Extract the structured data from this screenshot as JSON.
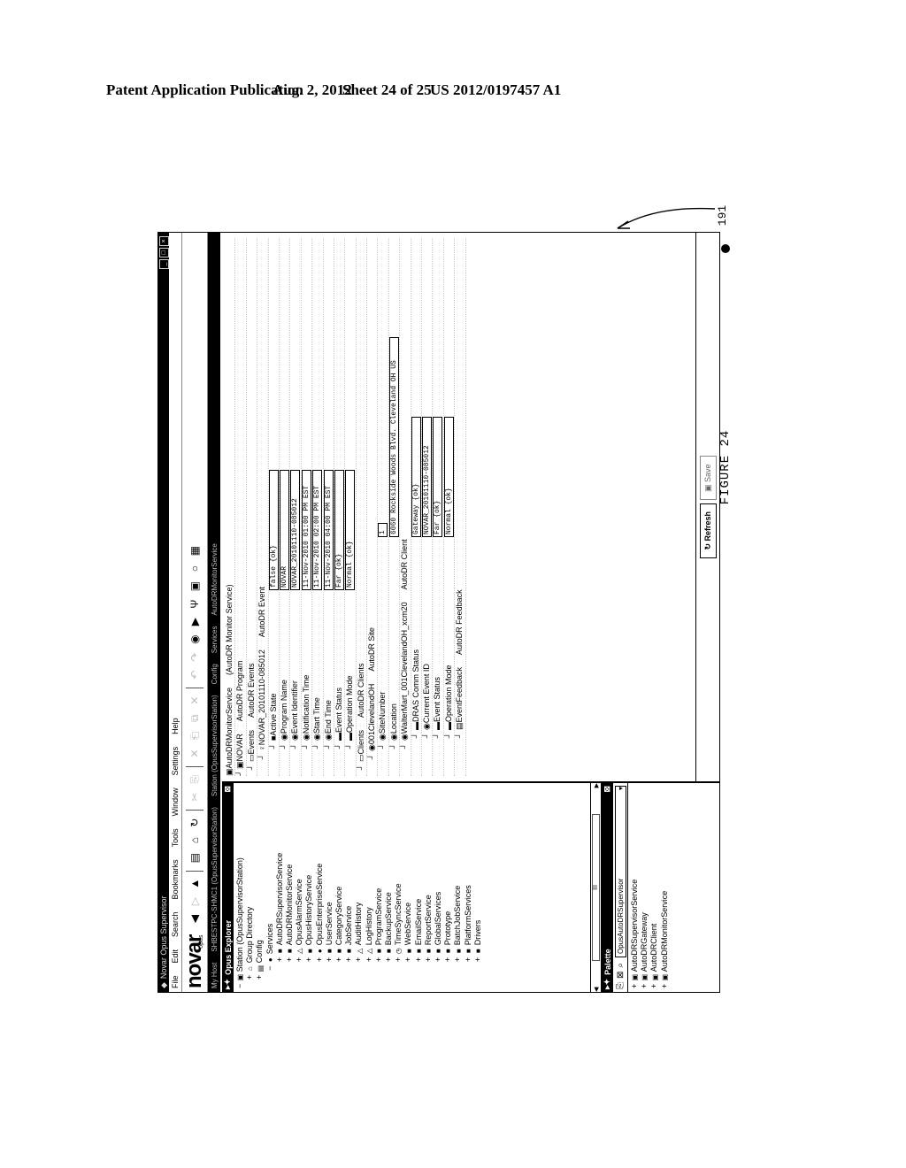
{
  "patent": {
    "title": "Patent Application Publication",
    "date": "Aug. 2, 2012",
    "sheet": "Sheet 24 of 25",
    "number": "US 2012/0197457 A1",
    "figure": "FIGURE 24",
    "reference": "191"
  },
  "window": {
    "title": "Novar Opus Supervisor",
    "menu": [
      "File",
      "Edit",
      "Search",
      "Bookmarks",
      "Tools",
      "Window",
      "Settings",
      "Help"
    ],
    "logo": "novar",
    "logo_sub": "opus",
    "address": [
      "My Host",
      "SHBESTPC-SHMC1 (OpusSupervisorStation)",
      "Station (OpusSupervisorStation)",
      "Config",
      "Services",
      "AutoDRMonitorService"
    ]
  },
  "explorer": {
    "title": "Opus Explorer",
    "items": [
      {
        "label": "Station (OpusSupervisorStation)",
        "icon": "station-icon"
      },
      {
        "label": "Group Directory",
        "icon": "folder-icon"
      },
      {
        "label": "Config",
        "icon": "config-icon"
      },
      {
        "label": "Services",
        "icon": "services-icon"
      },
      {
        "label": "AutoDRSupervisorService",
        "icon": "service-icon"
      },
      {
        "label": "AutoDRMonitorService",
        "icon": "service-icon"
      },
      {
        "label": "OpusAlarmService",
        "icon": "bell-icon"
      },
      {
        "label": "OpusHistoryService",
        "icon": "history-icon"
      },
      {
        "label": "OpusEnterpriseService",
        "icon": "globe-icon"
      },
      {
        "label": "UserService",
        "icon": "user-icon"
      },
      {
        "label": "CategoryService",
        "icon": "category-icon"
      },
      {
        "label": "JobService",
        "icon": "job-icon"
      },
      {
        "label": "AuditHistory",
        "icon": "triangle-icon"
      },
      {
        "label": "LogHistory",
        "icon": "triangle-icon"
      },
      {
        "label": "ProgramService",
        "icon": "program-icon"
      },
      {
        "label": "BackupService",
        "icon": "backup-icon"
      },
      {
        "label": "TimeSyncService",
        "icon": "clock-icon"
      },
      {
        "label": "WebService",
        "icon": "web-icon"
      },
      {
        "label": "EmailService",
        "icon": "email-icon"
      },
      {
        "label": "ReportService",
        "icon": "report-icon"
      },
      {
        "label": "GlobalServices",
        "icon": "global-icon"
      },
      {
        "label": "Prototype",
        "icon": "prototype-icon"
      },
      {
        "label": "BatchJobService",
        "icon": "batch-icon"
      },
      {
        "label": "PlatformServices",
        "icon": "platform-icon"
      },
      {
        "label": "Drivers",
        "icon": "drivers-icon"
      }
    ],
    "scroll_label": "III"
  },
  "palette": {
    "title": "Palette",
    "selected": "OpusAutoDRSupervisor",
    "items": [
      "AutoDRSupervisorService",
      "AutoDRGateway",
      "AutoDRClient",
      "AutoDRMonitorService"
    ]
  },
  "property_sheet": {
    "root": {
      "label": "AutoDRMonitorService",
      "type": "(AutoDR Monitor Service)"
    },
    "rows": [
      {
        "label": "NOVAR",
        "type": "AutoDR Program"
      },
      {
        "label": "Events",
        "type": "AutoDR Events"
      },
      {
        "label": "NOVAR_20101110-085012",
        "type": "AutoDR Event"
      },
      {
        "label": "Active State",
        "value": "false {ok}"
      },
      {
        "label": "Program Name",
        "value": "NOVAR"
      },
      {
        "label": "Event Identifier",
        "value": "NOVAR_20101110-085012"
      },
      {
        "label": "Notification Time",
        "value": "11-Nov-2010 01:00 PM EST"
      },
      {
        "label": "Start Time",
        "value": "11-Nov-2010 02:00 PM EST"
      },
      {
        "label": "End Time",
        "value": "11-Nov-2010 04:00 PM EST"
      },
      {
        "label": "Event Status",
        "value": "Far {ok}"
      },
      {
        "label": "Operation Mode",
        "value": "Normal {ok}"
      },
      {
        "label": "Clients",
        "type": "AutoDR Clients"
      },
      {
        "label": "001ClevelandOH",
        "type": "AutoDR Site"
      },
      {
        "label": "SiteNumber",
        "value": "1"
      },
      {
        "label": "Location",
        "value": "6060 Rockside Woods Blvd. Cleveland OH US"
      },
      {
        "label": "WalterMart_001ClevelandOH_xcm20",
        "type": "AutoDR Client"
      },
      {
        "label": "DRAS Comm Status",
        "value": "Gateway {ok}"
      },
      {
        "label": "Current Event ID",
        "value": "NOVAR_20101110-085012"
      },
      {
        "label": "Event Status",
        "value": "Far {ok}"
      },
      {
        "label": "Operation Mode",
        "value": "Normal {ok}"
      },
      {
        "label": "EventFeedback",
        "type": "AutoDR Feedback"
      }
    ],
    "refresh_label": "Refresh",
    "save_label": "Save"
  }
}
